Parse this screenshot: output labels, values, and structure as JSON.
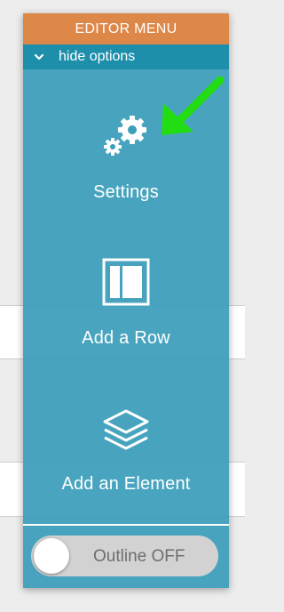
{
  "panel": {
    "title": "EDITOR MENU",
    "hide_label": "hide options",
    "colors": {
      "header": "#dd8748",
      "hide_bar": "#1e8fab",
      "panel": "#3b9eba",
      "arrow": "#22dd11"
    }
  },
  "menu": {
    "settings": {
      "label": "Settings",
      "icon": "gears-icon"
    },
    "add_row": {
      "label": "Add a Row",
      "icon": "layout-columns-icon"
    },
    "add_element": {
      "label": "Add an Element",
      "icon": "layers-icon"
    }
  },
  "outline_toggle": {
    "label": "Outline OFF",
    "state": "off"
  }
}
